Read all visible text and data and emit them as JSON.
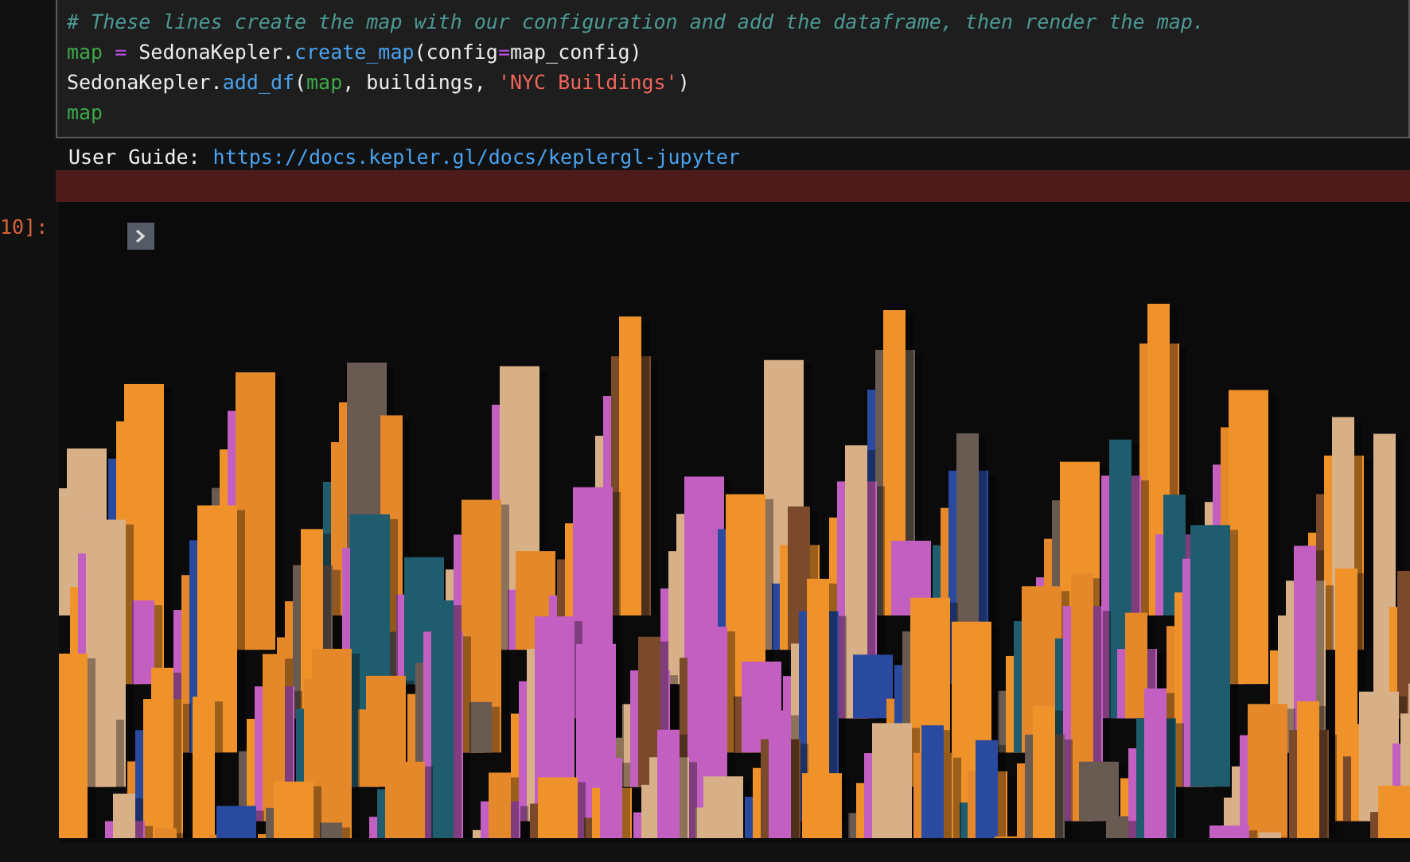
{
  "code_cell": {
    "lines": [
      [
        {
          "text": "# These lines create the map with our configuration and add the dataframe, then render the map.",
          "kind": "comment"
        }
      ],
      [
        {
          "text": "map",
          "kind": "variable"
        },
        {
          "text": " = ",
          "kind": "operator"
        },
        {
          "text": "SedonaKepler.",
          "kind": "plain"
        },
        {
          "text": "create_map",
          "kind": "function"
        },
        {
          "text": "(config",
          "kind": "plain"
        },
        {
          "text": "=",
          "kind": "operator"
        },
        {
          "text": "map_config)",
          "kind": "plain"
        }
      ],
      [
        {
          "text": "SedonaKepler.",
          "kind": "plain"
        },
        {
          "text": "add_df",
          "kind": "function"
        },
        {
          "text": "(",
          "kind": "plain"
        },
        {
          "text": "map",
          "kind": "variable"
        },
        {
          "text": ", buildings, ",
          "kind": "plain"
        },
        {
          "text": "'NYC Buildings'",
          "kind": "string"
        },
        {
          "text": ")",
          "kind": "plain"
        }
      ],
      [
        {
          "text": "map",
          "kind": "variable"
        }
      ]
    ]
  },
  "output": {
    "guide_label": "User Guide:",
    "guide_link": "https://docs.kepler.gl/docs/keplergl-jupyter"
  },
  "prompt": "10]:",
  "map": {
    "expanded": false
  }
}
